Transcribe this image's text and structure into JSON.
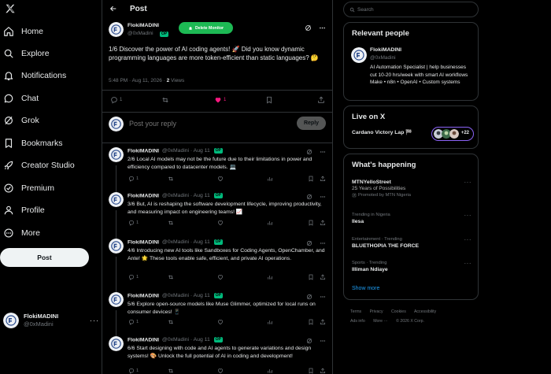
{
  "sidebar": {
    "logo": "x-logo-icon",
    "items": [
      {
        "label": "Home",
        "icon": "home-icon"
      },
      {
        "label": "Explore",
        "icon": "search-icon"
      },
      {
        "label": "Notifications",
        "icon": "bell-icon"
      },
      {
        "label": "Chat",
        "icon": "chat-icon"
      },
      {
        "label": "Grok",
        "icon": "grok-icon"
      },
      {
        "label": "Bookmarks",
        "icon": "bookmark-icon"
      },
      {
        "label": "Creator Studio",
        "icon": "rocket-icon"
      },
      {
        "label": "Premium",
        "icon": "premium-icon"
      },
      {
        "label": "Profile",
        "icon": "person-icon"
      },
      {
        "label": "More",
        "icon": "more-circle-icon"
      }
    ],
    "post_button": "Post",
    "account": {
      "name": "FlokiMADINI",
      "handle": "@0xMadini",
      "more": "···"
    }
  },
  "header": {
    "title": "Post"
  },
  "main_post": {
    "name": "FlokiMADINI",
    "handle": "@0xMadini",
    "badge": "OP",
    "delete_button": "Delete Monitor",
    "text": "1/6 Discover the power of AI coding agents! 🚀 Did you know dynamic programming languages are more token-efficient than static languages? 🤔",
    "timestamp": "5:48 PM · Aug 11, 2026 · ",
    "views_count": "2",
    "views_label": "Views",
    "stats": {
      "replies": "1",
      "reposts": "",
      "likes": "1",
      "bookmarks": ""
    }
  },
  "reply_composer": {
    "placeholder": "Post your reply",
    "button": "Reply"
  },
  "replies": [
    {
      "name": "FlokiMADINI",
      "handle": "@0xMadini · Aug 11",
      "badge": "OP",
      "text": "2/6 Local AI models may not be the future due to their limitations in power and efficiency compared to datacenter models. 💻",
      "replies": "1"
    },
    {
      "name": "FlokiMADINI",
      "handle": "@0xMadini · Aug 11",
      "badge": "OP",
      "text": "3/6 But, AI is reshaping the software development lifecycle, improving productivity, and measuring impact on engineering teams! 📈",
      "replies": "1"
    },
    {
      "name": "FlokiMADINI",
      "handle": "@0xMadini · Aug 11",
      "badge": "OP",
      "text": "4/6 Introducing new AI tools like Sandboxes for Coding Agents, OpenChamber, and Ante! 🌟 These tools enable safe, efficient, and private AI operations.",
      "replies": "1"
    },
    {
      "name": "FlokiMADINI",
      "handle": "@0xMadini · Aug 11",
      "badge": "OP",
      "text": "5/6 Explore open-source models like Muse Glimmer, optimized for local runs on consumer devices! 📱",
      "replies": "1"
    },
    {
      "name": "FlokiMADINI",
      "handle": "@0xMadini · Aug 11",
      "badge": "OP",
      "text": "6/6 Start designing with code and AI agents to generate variations and design systems! 🎨 Unlock the full potential of AI in coding and development!",
      "replies": "1"
    }
  ],
  "right": {
    "search_placeholder": "Search",
    "relevant": {
      "title": "Relevant people",
      "name": "FlokiMADINI",
      "handle": "@0xMadini",
      "bio": "AI Automation Specialist | help businesses cut 10-20 hrs/week with smart AI workflows Make • n8n • OpenAI • Custom systems"
    },
    "live": {
      "title": "Live on X",
      "item": "Cardano Victory Lap 🏁",
      "count": "+22"
    },
    "happening": {
      "title": "What's happening",
      "trends": [
        {
          "line1": "MTNYelloStreet",
          "line2": "25 Years of Possibilities",
          "line3": "Promoted by MTN Nigeria"
        },
        {
          "line1": "Trending in Nigeria",
          "line2": "Ilesa"
        },
        {
          "line1": "Entertainment · Trending",
          "line2": "BLUETHOPIA THE FORCE"
        },
        {
          "line1": "Sports · Trending",
          "line2": "Illiman Ndiaye"
        }
      ],
      "show_more": "Show more"
    },
    "footer": {
      "row1": [
        "Terms",
        "Privacy",
        "Cookies",
        "Accessibility"
      ],
      "row2": [
        "Ads info",
        "More ···",
        "© 2026 X Corp."
      ]
    }
  },
  "colors": {
    "accent": "#1d9bf0",
    "op_badge": "#00ba7c",
    "delete_button": "#1db954",
    "like": "#f91880"
  }
}
